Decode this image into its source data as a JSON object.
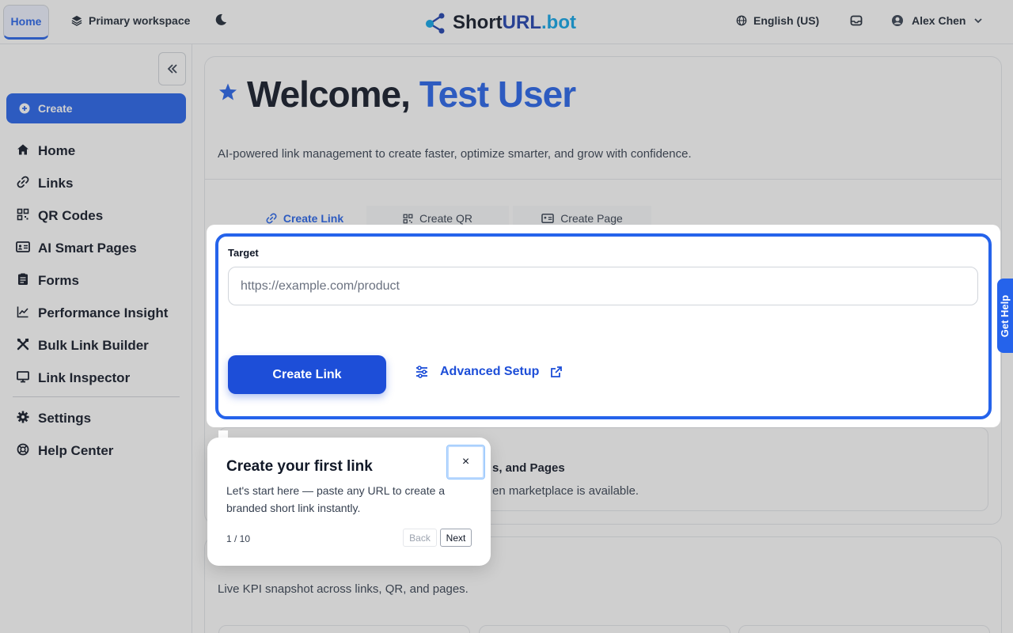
{
  "topbar": {
    "home_tab": "Home",
    "workspace": "Primary workspace",
    "logo": {
      "part1": "Short",
      "part2": "URL",
      "part3": ".bot"
    },
    "language": "English (US)",
    "user_name": "Alex Chen"
  },
  "sidebar": {
    "create_label": "Create",
    "items": [
      {
        "label": "Home",
        "icon": "home-icon"
      },
      {
        "label": "Links",
        "icon": "link-icon"
      },
      {
        "label": "QR Codes",
        "icon": "qr-icon"
      },
      {
        "label": "AI Smart Pages",
        "icon": "card-icon"
      },
      {
        "label": "Forms",
        "icon": "form-icon"
      },
      {
        "label": "Performance Insight",
        "icon": "chart-icon"
      },
      {
        "label": "Bulk Link Builder",
        "icon": "tools-icon"
      },
      {
        "label": "Link Inspector",
        "icon": "monitor-icon"
      }
    ],
    "bottom_items": [
      {
        "label": "Settings",
        "icon": "gear-icon"
      },
      {
        "label": "Help Center",
        "icon": "lifebuoy-icon"
      }
    ]
  },
  "main": {
    "welcome_prefix": "Welcome,",
    "welcome_name": "Test User",
    "subtitle": "AI-powered link management to create faster, optimize smarter, and grow with confidence.",
    "tabs": [
      {
        "label": "Create Link"
      },
      {
        "label": "Create QR"
      },
      {
        "label": "Create Page"
      }
    ],
    "form": {
      "target_label": "Target",
      "target_placeholder": "https://example.com/product",
      "create_button": "Create Link",
      "advanced_label": "Advanced Setup"
    },
    "marketplace": {
      "title_fragment": "s, and Pages",
      "desc_fragment": "en marketplace is available."
    },
    "kpi": {
      "desc": "Live KPI snapshot across links, QR, and pages."
    }
  },
  "help": {
    "label": "Get Help"
  },
  "tour": {
    "title": "Create your first link",
    "body": "Let's start here — paste any URL to create a branded short link instantly.",
    "close": "×",
    "step": "1 / 10",
    "back": "Back",
    "next": "Next"
  },
  "colors": {
    "accent": "#2563eb",
    "accent_dark": "#1d4ed8",
    "logo_bot": "#0ea5e9"
  }
}
